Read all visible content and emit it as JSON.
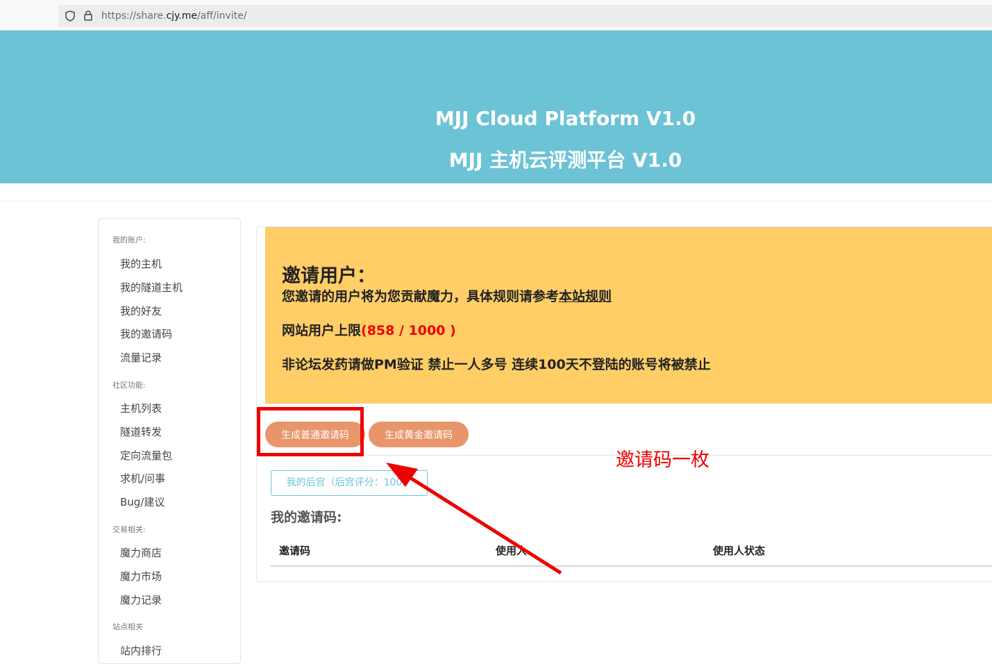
{
  "browser": {
    "url_prefix": "https://share.",
    "url_host": "cjy.me",
    "url_path": "/aff/invite/"
  },
  "header": {
    "title_en": "MJJ Cloud Platform V1.0",
    "title_zh": "MJJ 主机云评测平台 V1.0"
  },
  "sidebar": {
    "groups": [
      {
        "label": "我的账户:",
        "items": [
          "我的主机",
          "我的隧道主机",
          "我的好友",
          "我的邀请码",
          "流量记录"
        ]
      },
      {
        "label": "社区功能:",
        "items": [
          "主机列表",
          "隧道转发",
          "定向流量包",
          "求机/问事",
          "Bug/建议"
        ]
      },
      {
        "label": "交易相关:",
        "items": [
          "魔力商店",
          "魔力市场",
          "魔力记录"
        ]
      },
      {
        "label": "站点相关",
        "items": [
          "站内排行"
        ]
      }
    ]
  },
  "notice": {
    "title": "邀请用户：",
    "line1_prefix": "您邀请的用户将为您贡献魔力，具体规则请参考",
    "line1_link": "本站规则",
    "line2_prefix": "网站用户上限",
    "line2_value": "(858 / 1000 )",
    "line3": "非论坛发药请做PM验证 禁止一人多号 连续100天不登陆的账号将被禁止"
  },
  "actions": {
    "normal_code_label": "生成普通邀请码",
    "gold_code_label": "生成黄金邀请码",
    "harem_label": "我的后宫（后宫评分：100）"
  },
  "codes": {
    "title": "我的邀请码:",
    "columns": [
      "邀请码",
      "使用人",
      "使用人状态"
    ]
  },
  "annotation": {
    "text": "邀请码一枚",
    "color": "#ee0000"
  },
  "colors": {
    "hero": "#6cc3d5",
    "notice": "#ffce67",
    "button": "#e8956b"
  }
}
